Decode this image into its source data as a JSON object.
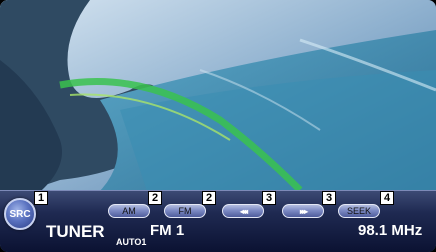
{
  "source_button": {
    "label": "SRC"
  },
  "buttons": [
    {
      "label": "AM",
      "number": "2"
    },
    {
      "label": "FM",
      "number": "2"
    },
    {
      "label": "",
      "glyph": "◂◂◂",
      "icon": "seek-back-icon",
      "number": "3"
    },
    {
      "label": "",
      "glyph": "▸▸▸",
      "icon": "seek-forward-icon",
      "number": "3"
    },
    {
      "label": "SEEK",
      "number": "4"
    }
  ],
  "src_number": "1",
  "status": {
    "source": "TUNER",
    "auto_mode": "AUTO1",
    "band": "FM 1",
    "frequency": "98.1 MHz"
  },
  "colors": {
    "bar": "#1f2a52",
    "button": "#7d8bc4",
    "text": "#ffffff",
    "callout_bg": "#ffffff"
  }
}
